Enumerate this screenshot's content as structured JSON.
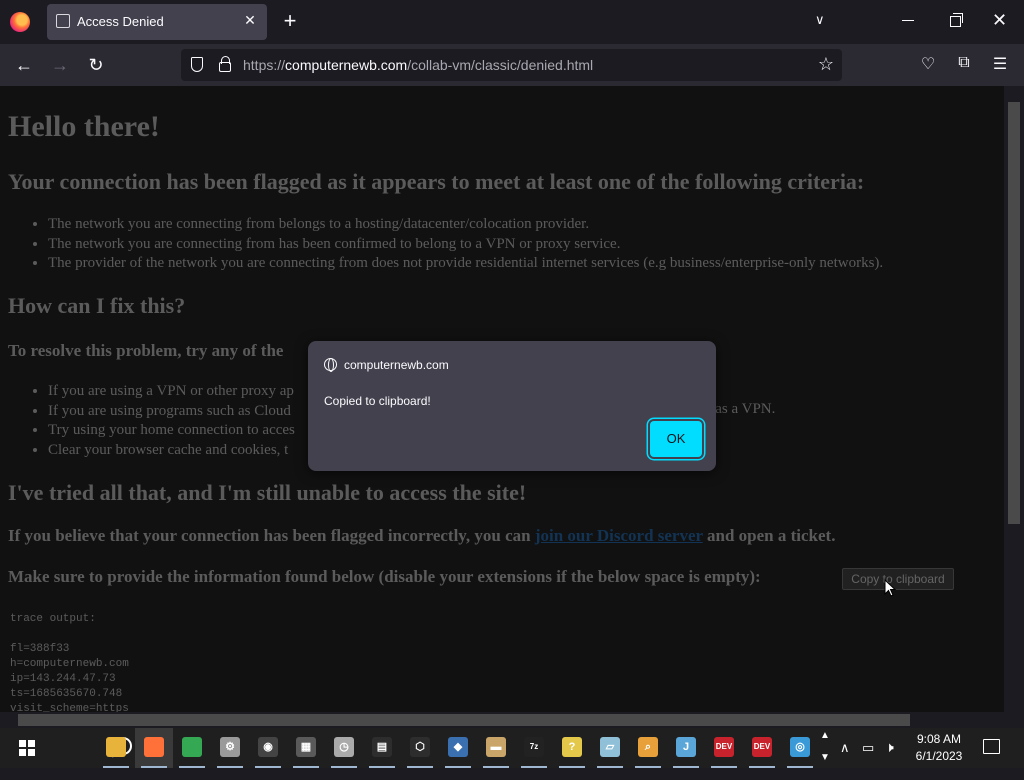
{
  "browser": {
    "tab_title": "Access Denied",
    "url_prefix": "https://",
    "url_host": "computernewb.com",
    "url_path": "/collab-vm/classic/denied.html"
  },
  "page": {
    "heading": "Hello there!",
    "flagged_heading": "Your connection has been flagged as it appears to meet at least one of the following criteria:",
    "criteria": [
      "The network you are connecting from belongs to a hosting/datacenter/colocation provider.",
      "The network you are connecting from has been confirmed to belong to a VPN or proxy service.",
      "The provider of the network you are connecting from does not provide residential internet services (e.g business/enterprise-only networks)."
    ],
    "fix_heading": "How can I fix this?",
    "resolve_text": "To resolve this problem, try any of the",
    "fixes": [
      "If you are using a VPN or other proxy ap",
      "If you are using programs such as Cloud",
      "Try using your home connection to acces",
      "Clear your browser cache and cookies, t"
    ],
    "fix2_tail": "g as a VPN.",
    "tried_heading": "I've tried all that, and I'm still unable to access the site!",
    "believe_text": "If you believe that your connection has been flagged incorrectly, you can",
    "discord_link": "join our Discord server",
    "ticket_text": "and open a ticket.",
    "provide_text": "Make sure to provide the information found below (disable your extensions if the below space is empty):",
    "copy_button": "Copy to clipboard",
    "trace": "trace output:\n\nfl=388f33\nh=computernewb.com\nip=143.244.47.73\nts=1685635670.748\nvisit_scheme=https"
  },
  "dialog": {
    "origin": "computernewb.com",
    "message": "Copied to clipboard!",
    "ok_label": "OK"
  },
  "taskbar": {
    "time": "9:08 AM",
    "date": "6/1/2023",
    "apps": [
      {
        "name": "file-explorer-icon",
        "color": "#e8b33a",
        "label": ""
      },
      {
        "name": "firefox-icon",
        "color": "#ff7139",
        "label": ""
      },
      {
        "name": "chrome-icon",
        "color": "#34a853",
        "label": ""
      },
      {
        "name": "settings-icon",
        "color": "#9a9a9a",
        "label": "⚙"
      },
      {
        "name": "camera-icon",
        "color": "#444444",
        "label": "◉"
      },
      {
        "name": "calculator-icon",
        "color": "#5a5a5a",
        "label": "▦"
      },
      {
        "name": "clock-icon",
        "color": "#aaaaaa",
        "label": "◷"
      },
      {
        "name": "calendar-icon",
        "color": "#2d2d2d",
        "label": "▤"
      },
      {
        "name": "3d-viewer-icon",
        "color": "#2d2d2d",
        "label": "⬡"
      },
      {
        "name": "virtualbox-icon",
        "color": "#3a6fb0",
        "label": "◆"
      },
      {
        "name": "archive-icon",
        "color": "#c9a56a",
        "label": "▬"
      },
      {
        "name": "7zip-icon",
        "color": "#222222",
        "label": "7z"
      },
      {
        "name": "help-icon",
        "color": "#e4c84a",
        "label": "?"
      },
      {
        "name": "notepad-icon",
        "color": "#8fc0d8",
        "label": "▱"
      },
      {
        "name": "search-tool-icon",
        "color": "#e8a13a",
        "label": "⌕"
      },
      {
        "name": "java-icon",
        "color": "#5aa6d8",
        "label": "J"
      },
      {
        "name": "devcpp-icon-1",
        "color": "#c8232c",
        "label": "DEV"
      },
      {
        "name": "devcpp-icon-2",
        "color": "#c8232c",
        "label": "DEV"
      },
      {
        "name": "network-app-icon",
        "color": "#3a9ad8",
        "label": "◎"
      }
    ]
  }
}
